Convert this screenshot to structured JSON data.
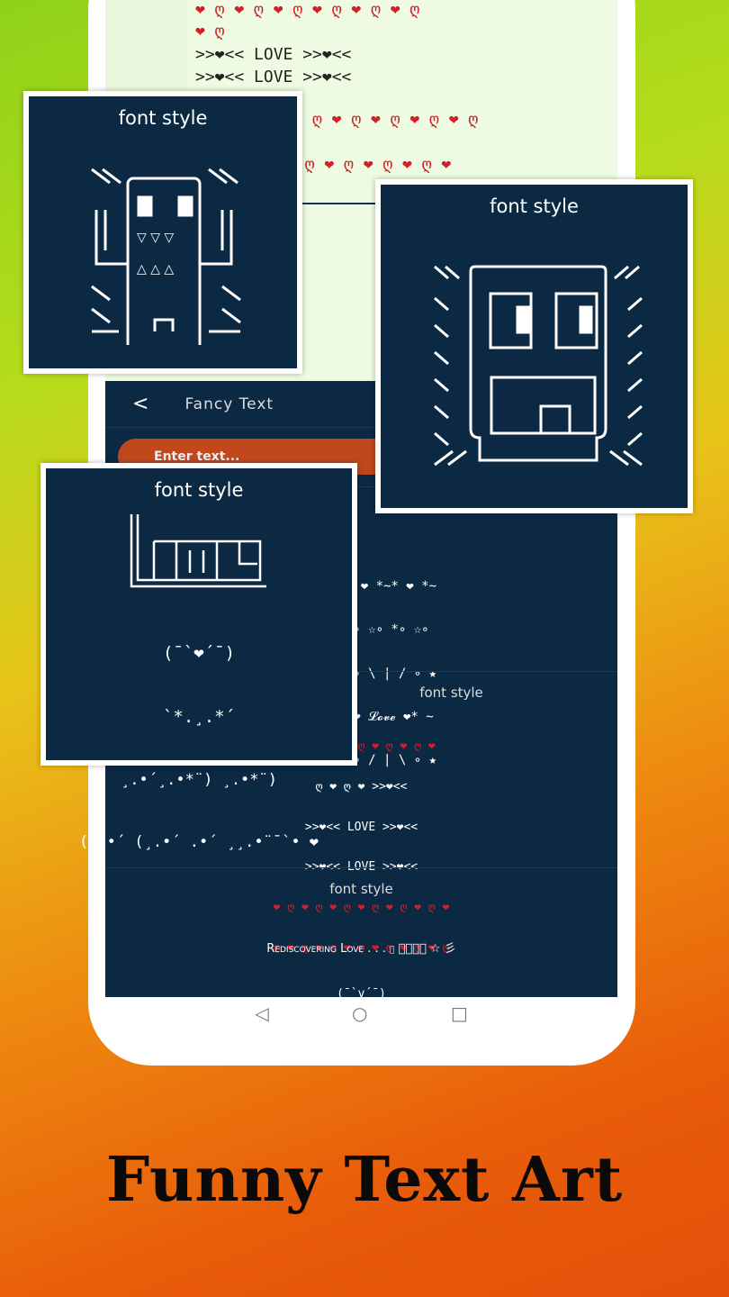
{
  "app": {
    "title": "Fancy Text",
    "back_icon": "chevron-left-icon",
    "input_placeholder": "Enter text..."
  },
  "colors": {
    "navy": "#0c2944",
    "accent": "#c0481c",
    "heart": "#d21f2a"
  },
  "preview_rows": [
    "❤ ღ ❤ ღ ❤ ღ ❤ ღ ❤ ღ ❤ ღ",
    "❤ ღ",
    ">>❤<< LOVE >>❤<<",
    ">>❤<< LOVE >>❤<<",
    "ღ ❤ ღ ❤ ღ ❤ ღ ❤ ღ",
    "❤ ღ ❤ ღ ❤ ღ ❤ ღ ❤"
  ],
  "sections": [
    {
      "title": "font style"
    },
    {
      "title": "font style",
      "lines": [
        "*~* ❤ *~* ❤ *~",
        "...∘ ☆∘ *∘ ☆∘",
        "..★∘ \\ | / ∘ ★",
        "~ *❤ 𝓛𝓸𝓿𝓮 ❤* ~",
        "..★∘ / | \\ ∘ ★"
      ]
    },
    {
      "title": "font style",
      "lines": [
        "❤ ღ ❤ ღ ❤ ღ ❤ ღ ❤ ღ ❤",
        "ღ ❤ ღ ❤ >>❤<<",
        ">>❤<< LOVE >>❤<<",
        ">>❤<< LOVE >>❤<<",
        "❤ ღ ❤ ღ ❤ ღ ❤ ღ ❤ ღ ❤ ღ ❤",
        "ღ ❤ ღ ❤ ღ ❤ ღ ❤ ღ ❤ ღ ❤ ღ"
      ]
    },
    {
      "title": "font style",
      "lines": [
        "Rediscovering Love . . . ღ 𝓛𝓸𝓿𝓮 ☆ 彡",
        "(¯`v´¯)",
        "`*.¸.*´",
        "☻/",
        "/▌"
      ]
    }
  ],
  "cards": [
    {
      "title": "font style",
      "art": "robot"
    },
    {
      "title": "font style",
      "art": "face"
    },
    {
      "title": "font style",
      "art": "love",
      "lines": [
        "(¯`❤´¯)",
        "`*.¸.*´",
        "¸.•´¸.•*¨) ¸.•*¨)",
        "(¸.•´ (¸.•´ .•´ ¸¸.•¨¯`• ❤"
      ]
    }
  ],
  "navbar": {
    "back": "◁",
    "home": "○",
    "recent": "□"
  },
  "headline": "Funny Text Art"
}
